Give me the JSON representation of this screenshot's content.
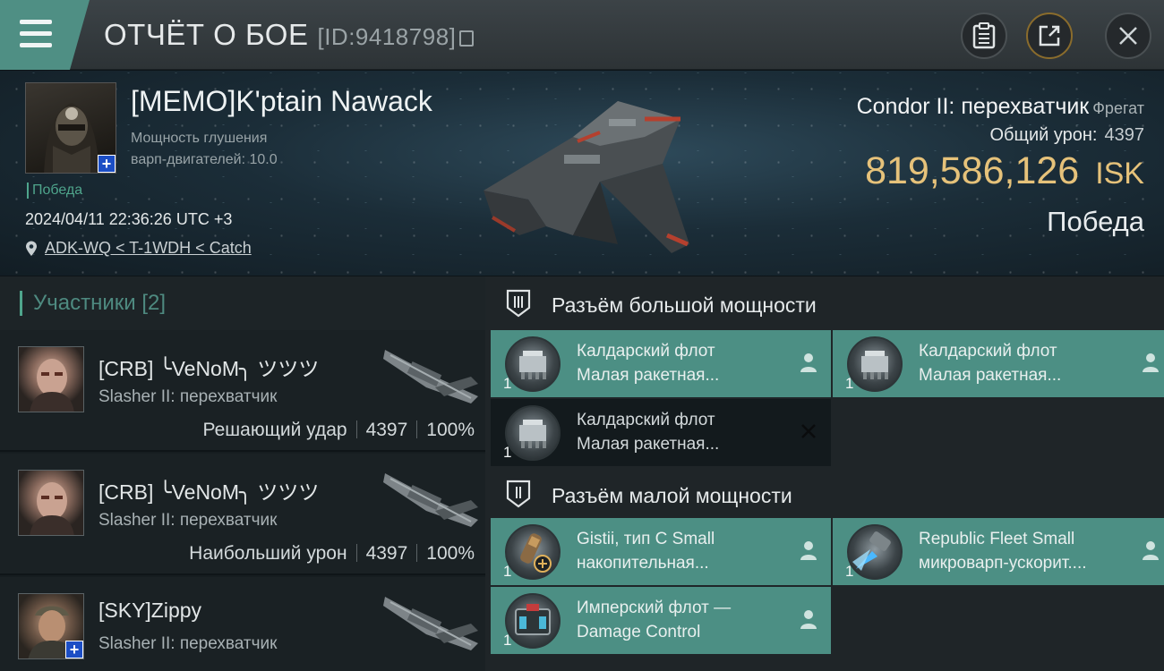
{
  "header": {
    "title": "ОТЧЁТ О БОЕ",
    "id_text": "[ID:9418798]"
  },
  "victim": {
    "name": "[MEMO]K'ptain Nawack",
    "stat_line1": "Мощность глушения",
    "stat_line2": "варп-двигателей: 10.0",
    "status": "Победа",
    "timestamp": "2024/04/11 22:36:26 UTC +3",
    "location": "ADK-WQ < T-1WDH < Catch",
    "ship_name": "Condor II: перехватчик",
    "ship_class": "Фрегат",
    "total_damage_label": "Общий урон:",
    "total_damage_value": "4397",
    "isk_value": "819,586,126",
    "isk_unit": "ISK",
    "outcome": "Победа"
  },
  "participants": {
    "label": "Участники [2]",
    "rows": [
      {
        "name": "[CRB] ╰VeNoM╮ ツツツ",
        "ship": "Slasher II: перехватчик",
        "role": "Решающий удар",
        "damage": "4397",
        "percent": "100%"
      },
      {
        "name": "[CRB] ╰VeNoM╮ ツツツ",
        "ship": "Slasher II: перехватчик",
        "role": "Наибольший урон",
        "damage": "4397",
        "percent": "100%"
      },
      {
        "name": "[SKY]Zippy",
        "ship": "Slasher II: перехватчик"
      }
    ]
  },
  "high_slots": {
    "title": "Разъём большой мощности",
    "items": [
      {
        "line1": "Калдарский флот",
        "line2": "Малая ракетная...",
        "qty": "1",
        "state": "dropped"
      },
      {
        "line1": "Калдарский флот",
        "line2": "Малая ракетная...",
        "qty": "1",
        "state": "dropped"
      },
      {
        "line1": "Калдарский флот",
        "line2": "Малая ракетная...",
        "qty": "1",
        "state": "destroyed"
      }
    ]
  },
  "low_slots": {
    "title": "Разъём малой мощности",
    "items": [
      {
        "line1": "Gistii, тип C Small",
        "line2": "накопительная...",
        "qty": "1",
        "state": "dropped"
      },
      {
        "line1": "Republic Fleet Small",
        "line2": "микроварп-ускорит....",
        "qty": "1",
        "state": "dropped"
      },
      {
        "line1": "Имперский флот —",
        "line2": "Damage Control",
        "qty": "1",
        "state": "dropped"
      }
    ]
  },
  "colors": {
    "accent_teal": "#4c8f84",
    "isk_gold": "#e6c27a",
    "victory_green": "#4fa58c"
  }
}
